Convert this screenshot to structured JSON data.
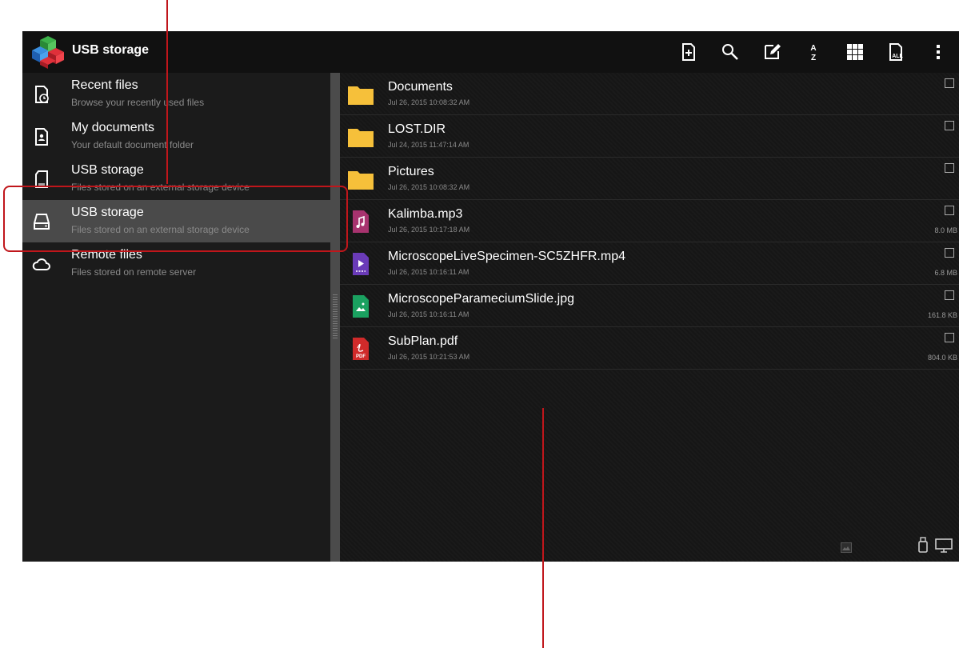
{
  "app": {
    "title": "USB storage"
  },
  "toolbar": {
    "buttons": [
      {
        "icon": "new-file-icon"
      },
      {
        "icon": "search-icon"
      },
      {
        "icon": "edit-icon"
      },
      {
        "icon": "sort-az-icon"
      },
      {
        "icon": "grid-view-icon"
      },
      {
        "icon": "select-all-icon"
      },
      {
        "icon": "overflow-menu-icon"
      }
    ],
    "sort_top": "A",
    "sort_bottom": "Z",
    "select_all_text": "ALL"
  },
  "sidebar": {
    "items": [
      {
        "title": "Recent files",
        "subtitle": "Browse your recently used files",
        "icon": "recent-files-icon",
        "selected": false
      },
      {
        "title": "My documents",
        "subtitle": "Your default document folder",
        "icon": "my-documents-icon",
        "selected": false
      },
      {
        "title": "USB storage",
        "subtitle": "Files stored on an external storage device",
        "icon": "sd-card-icon",
        "selected": false
      },
      {
        "title": "USB storage",
        "subtitle": "Files stored on an external storage device",
        "icon": "usb-drive-icon",
        "selected": true
      },
      {
        "title": "Remote files",
        "subtitle": "Files stored on remote server",
        "icon": "cloud-icon",
        "selected": false
      }
    ]
  },
  "files": [
    {
      "name": "Documents",
      "date": "Jul 26, 2015 10:08:32 AM",
      "size": "",
      "type": "folder"
    },
    {
      "name": "LOST.DIR",
      "date": "Jul 24, 2015 11:47:14 AM",
      "size": "",
      "type": "folder"
    },
    {
      "name": "Pictures",
      "date": "Jul 26, 2015 10:08:32 AM",
      "size": "",
      "type": "folder"
    },
    {
      "name": "Kalimba.mp3",
      "date": "Jul 26, 2015 10:17:18 AM",
      "size": "8.0 MB",
      "type": "audio"
    },
    {
      "name": "MicroscopeLiveSpecimen-SC5ZHFR.mp4",
      "date": "Jul 26, 2015 10:16:11 AM",
      "size": "6.8 MB",
      "type": "video"
    },
    {
      "name": "MicroscopeParameciumSlide.jpg",
      "date": "Jul 26, 2015 10:16:11 AM",
      "size": "161.8 KB",
      "type": "image"
    },
    {
      "name": "SubPlan.pdf",
      "date": "Jul 26, 2015 10:21:53 AM",
      "size": "804.0 KB",
      "type": "pdf"
    }
  ],
  "pdf_badge": "PDF",
  "colors": {
    "folder": "#f6c03a",
    "audio": "#a8336f",
    "video": "#6a3bb8",
    "image": "#1aa160",
    "pdf": "#d02a2a",
    "annotation": "#c0161b",
    "selected": "#4a4a4a"
  }
}
